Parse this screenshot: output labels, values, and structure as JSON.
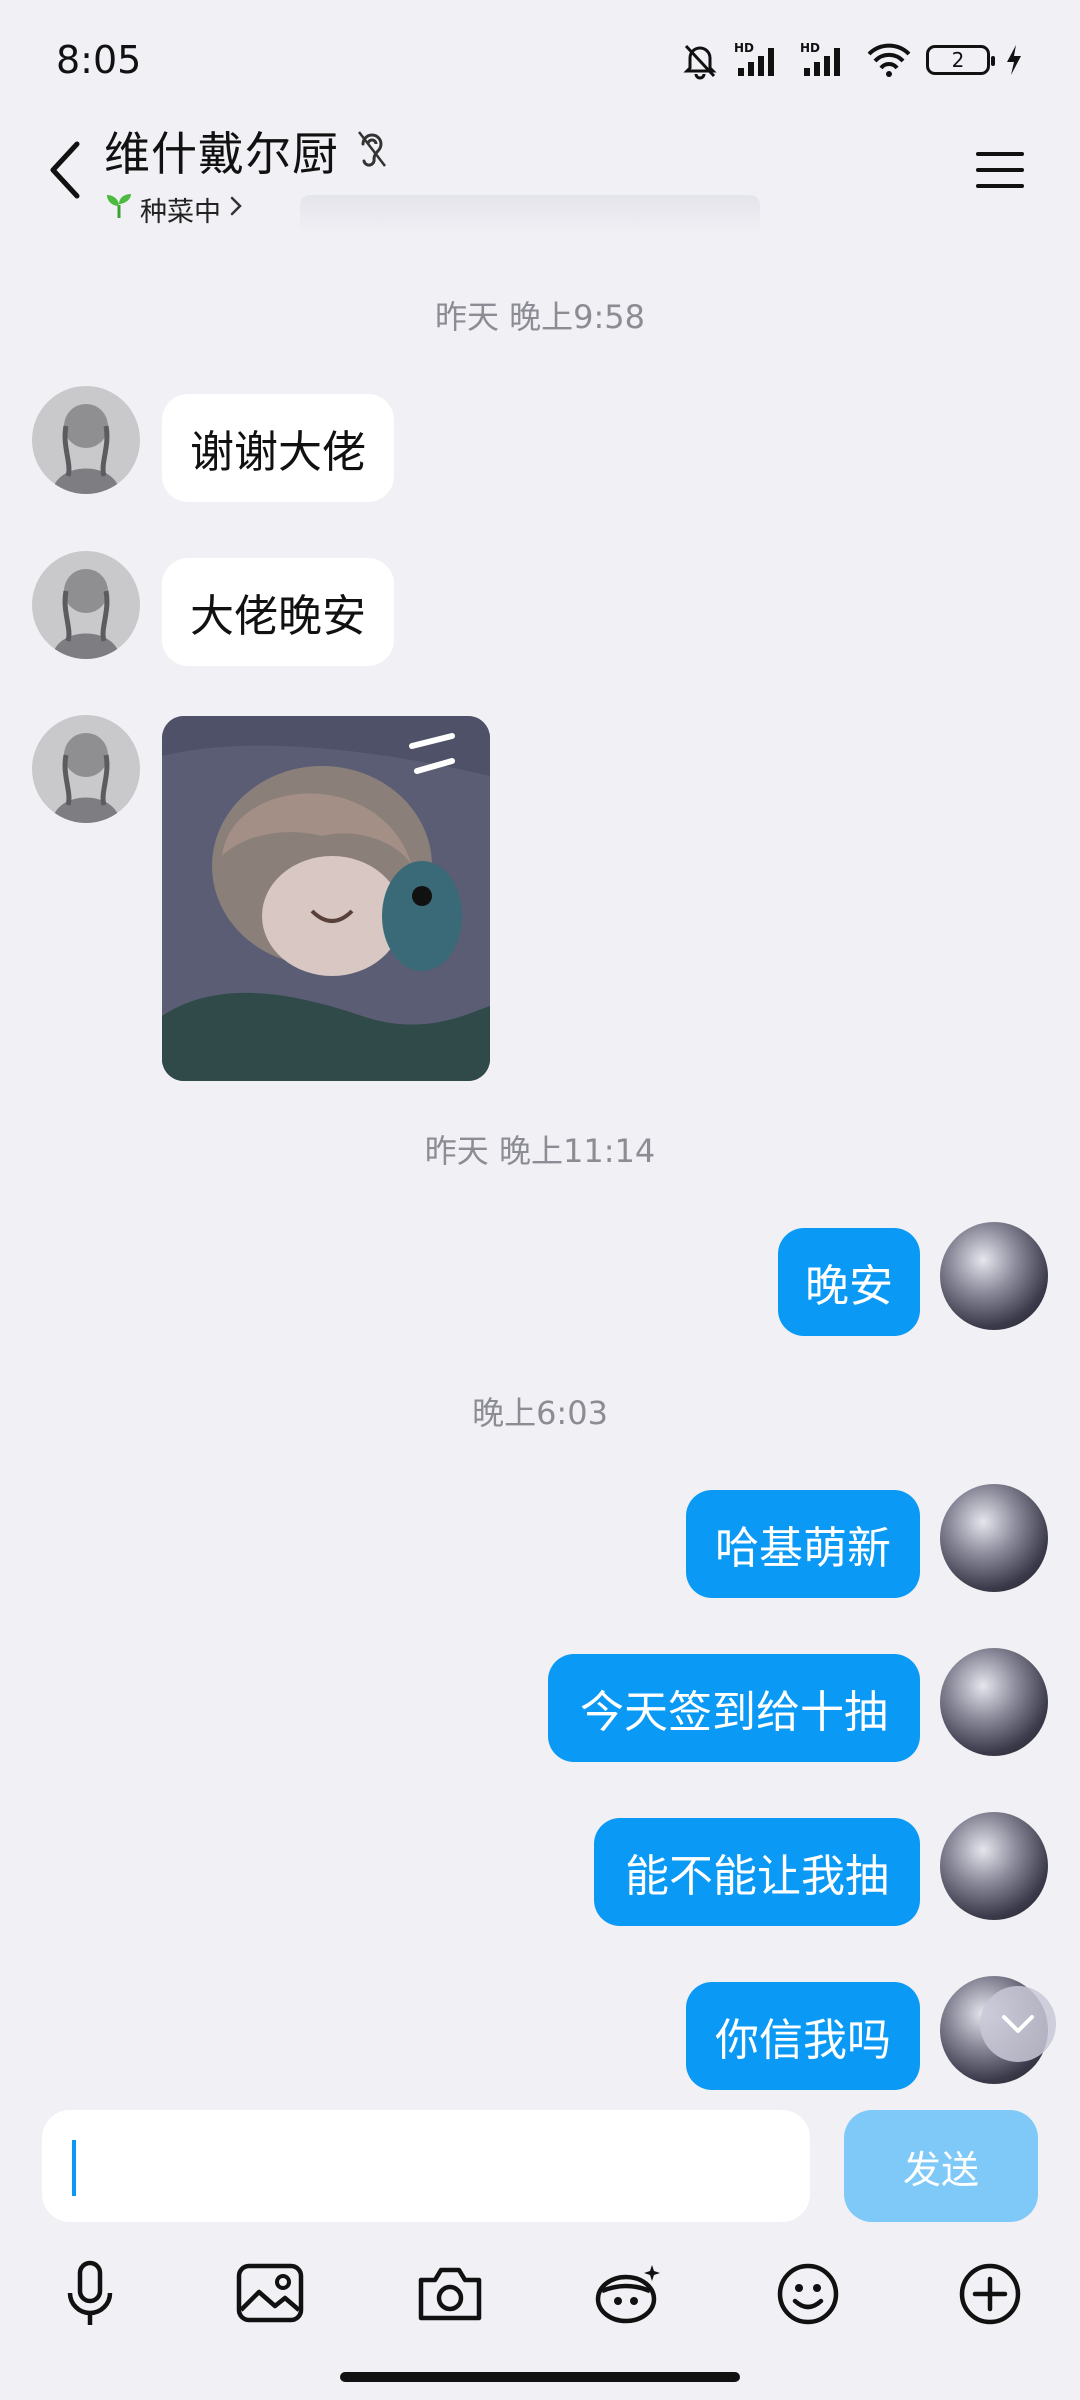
{
  "status_bar": {
    "time": "8:05",
    "battery": "2",
    "icons": [
      "mute-bell-icon",
      "hd-signal-icon",
      "hd-signal-icon",
      "wifi-icon",
      "battery-icon",
      "charging-icon"
    ]
  },
  "header": {
    "title": "维什戴尔厨",
    "subtitle": "种菜中",
    "icons": [
      "back-icon",
      "ear-icon",
      "sprout-icon",
      "chevron-right-icon",
      "menu-icon"
    ]
  },
  "messages": {
    "ts1": "昨天 晚上9:58",
    "m1": "谢谢大佬",
    "m2": "大佬晚安",
    "ts2": "昨天 晚上11:14",
    "m4": "晚安",
    "ts3": "晚上6:03",
    "m5": "哈基萌新",
    "m6": "今天签到给十抽",
    "m7": "能不能让我抽",
    "m8": "你信我吗"
  },
  "input": {
    "value": "",
    "send_label": "发送"
  },
  "toolbar": {
    "icons": [
      "microphone-icon",
      "image-icon",
      "camera-icon",
      "red-packet-icon",
      "emoji-icon",
      "plus-icon"
    ]
  },
  "colors": {
    "accent": "#0a99f5",
    "background": "#f0f0f5",
    "send_disabled": "#7fc9f8"
  }
}
